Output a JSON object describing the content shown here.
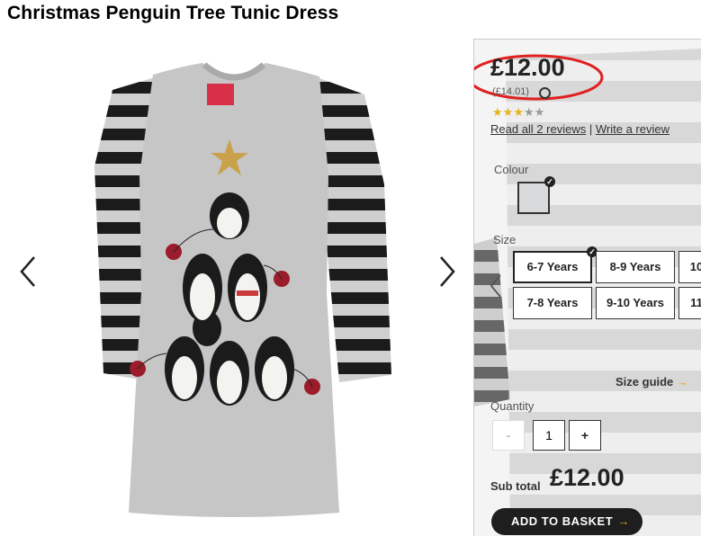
{
  "product": {
    "title": "Christmas Penguin Tree Tunic Dress",
    "price": "£12.00",
    "old_price": "(£14.01)",
    "rating_stars": 3,
    "rating_max": 5,
    "reviews_link": "Read all 2 reviews",
    "separator": "|",
    "write_review_link": "Write a review"
  },
  "colour": {
    "label": "Colour",
    "selected_swatch": "#d9dadc"
  },
  "size": {
    "label": "Size",
    "options": [
      "6-7 Years",
      "8-9 Years",
      "10",
      "7-8 Years",
      "9-10 Years",
      "11"
    ],
    "selected": "6-7 Years",
    "guide_label": "Size guide",
    "guide_arrow": "→"
  },
  "quantity": {
    "label": "Quantity",
    "minus": "-",
    "value": "1",
    "plus": "+"
  },
  "subtotal": {
    "label": "Sub total",
    "value": "£12.00"
  },
  "basket": {
    "label": "ADD TO BASKET",
    "icon_glyph": "→"
  },
  "icons": {
    "gallery_prev": "chevron-left-icon",
    "gallery_next": "chevron-right-icon",
    "checkmark": "check-icon"
  },
  "colors": {
    "annotation_ring": "#e02020",
    "star_on": "#e3b51f",
    "accent": "#e0a21e",
    "button_bg": "#1e1e1e"
  }
}
